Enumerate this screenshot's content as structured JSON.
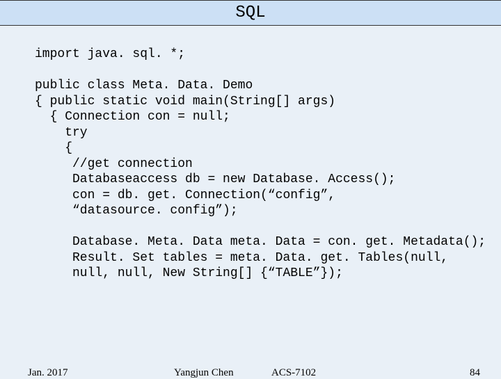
{
  "header": "SQL",
  "code": "import java. sql. *;\n\npublic class Meta. Data. Demo\n{ public static void main(String[] args)\n  { Connection con = null;\n    try\n    {\n     //get connection\n     Databaseaccess db = new Database. Access();\n     con = db. get. Connection(“config”,\n     “datasource. config”);\n\n     Database. Meta. Data meta. Data = con. get. Metadata();\n     Result. Set tables = meta. Data. get. Tables(null,\n     null, null, New String[] {“TABLE”});",
  "footer": {
    "date": "Jan. 2017",
    "author": "Yangjun Chen",
    "course": "ACS-7102",
    "page": "84"
  }
}
